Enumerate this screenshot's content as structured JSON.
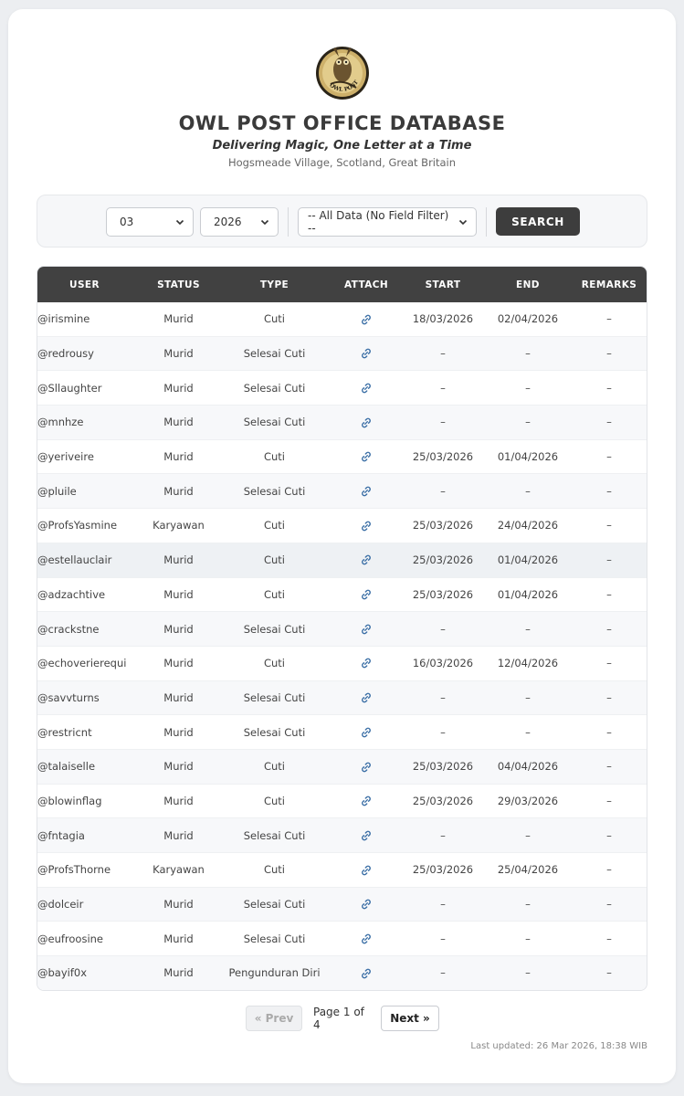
{
  "header": {
    "logo_alt": "owl-post-seal",
    "logo_text": "OWL POST",
    "title": "OWL POST OFFICE DATABASE",
    "tagline": "Delivering Magic, One Letter at a Time",
    "location": "Hogsmeade Village, Scotland, Great Britain"
  },
  "filters": {
    "month": "03",
    "year": "2026",
    "field": "-- All Data (No Field Filter) --",
    "search_label": "SEARCH"
  },
  "table": {
    "columns": [
      "USER",
      "STATUS",
      "TYPE",
      "ATTACH",
      "START",
      "END",
      "REMARKS"
    ],
    "rows": [
      {
        "user": "@irismine",
        "status": "Murid",
        "type": "Cuti",
        "start": "18/03/2026",
        "end": "02/04/2026",
        "remarks": "–"
      },
      {
        "user": "@redrousy",
        "status": "Murid",
        "type": "Selesai Cuti",
        "start": "–",
        "end": "–",
        "remarks": "–"
      },
      {
        "user": "@Sllaughter",
        "status": "Murid",
        "type": "Selesai Cuti",
        "start": "–",
        "end": "–",
        "remarks": "–"
      },
      {
        "user": "@mnhze",
        "status": "Murid",
        "type": "Selesai Cuti",
        "start": "–",
        "end": "–",
        "remarks": "–"
      },
      {
        "user": "@yeriveire",
        "status": "Murid",
        "type": "Cuti",
        "start": "25/03/2026",
        "end": "01/04/2026",
        "remarks": "–"
      },
      {
        "user": "@pluile",
        "status": "Murid",
        "type": "Selesai Cuti",
        "start": "–",
        "end": "–",
        "remarks": "–"
      },
      {
        "user": "@ProfsYasmine",
        "status": "Karyawan",
        "type": "Cuti",
        "start": "25/03/2026",
        "end": "24/04/2026",
        "remarks": "–"
      },
      {
        "user": "@estellauclair",
        "status": "Murid",
        "type": "Cuti",
        "start": "25/03/2026",
        "end": "01/04/2026",
        "remarks": "–"
      },
      {
        "user": "@adzachtive",
        "status": "Murid",
        "type": "Cuti",
        "start": "25/03/2026",
        "end": "01/04/2026",
        "remarks": "–"
      },
      {
        "user": "@crackstne",
        "status": "Murid",
        "type": "Selesai Cuti",
        "start": "–",
        "end": "–",
        "remarks": "–"
      },
      {
        "user": "@echoverierequi",
        "status": "Murid",
        "type": "Cuti",
        "start": "16/03/2026",
        "end": "12/04/2026",
        "remarks": "–"
      },
      {
        "user": "@savvturns",
        "status": "Murid",
        "type": "Selesai Cuti",
        "start": "–",
        "end": "–",
        "remarks": "–"
      },
      {
        "user": "@restricnt",
        "status": "Murid",
        "type": "Selesai Cuti",
        "start": "–",
        "end": "–",
        "remarks": "–"
      },
      {
        "user": "@talaiselle",
        "status": "Murid",
        "type": "Cuti",
        "start": "25/03/2026",
        "end": "04/04/2026",
        "remarks": "–"
      },
      {
        "user": "@blowinflag",
        "status": "Murid",
        "type": "Cuti",
        "start": "25/03/2026",
        "end": "29/03/2026",
        "remarks": "–"
      },
      {
        "user": "@fntagia",
        "status": "Murid",
        "type": "Selesai Cuti",
        "start": "–",
        "end": "–",
        "remarks": "–"
      },
      {
        "user": "@ProfsThorne",
        "status": "Karyawan",
        "type": "Cuti",
        "start": "25/03/2026",
        "end": "25/04/2026",
        "remarks": "–"
      },
      {
        "user": "@dolceir",
        "status": "Murid",
        "type": "Selesai Cuti",
        "start": "–",
        "end": "–",
        "remarks": "–"
      },
      {
        "user": "@eufroosine",
        "status": "Murid",
        "type": "Selesai Cuti",
        "start": "–",
        "end": "–",
        "remarks": "–"
      },
      {
        "user": "@bayif0x",
        "status": "Murid",
        "type": "Pengunduran Diri",
        "start": "–",
        "end": "–",
        "remarks": "–"
      }
    ],
    "attach_icon": "link-icon"
  },
  "pagination": {
    "prev_label": "« Prev",
    "page_info": "Page 1 of 4",
    "next_label": "Next »"
  },
  "footer": {
    "updated": "Last updated: 26 Mar 2026, 18:38 WIB"
  },
  "colors": {
    "header_bg": "#414141",
    "button_bg": "#3d3d3d",
    "link_icon": "#3a6ea5"
  }
}
